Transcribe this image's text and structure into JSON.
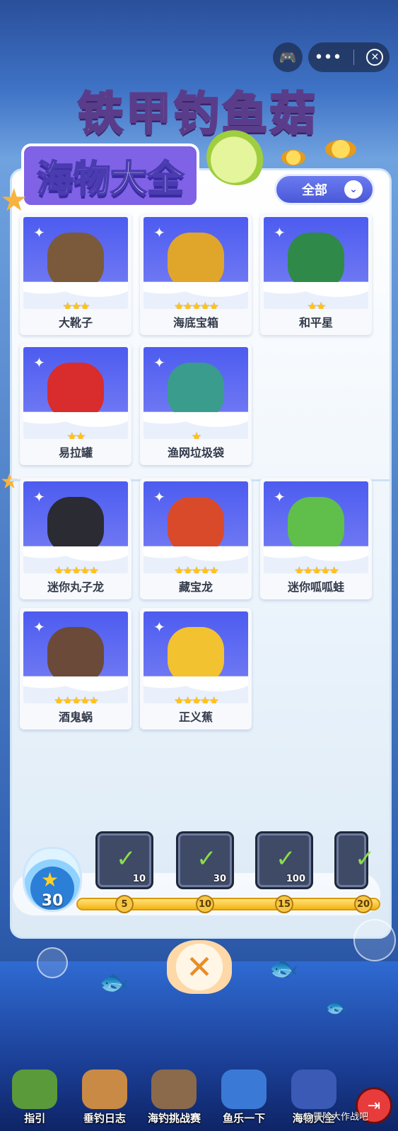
{
  "capsule": {
    "menu_glyph": "•••",
    "close_glyph": "✕",
    "gamepad_glyph": "🎮"
  },
  "game_title": "铁甲钓鱼菇",
  "panel_title": "海物大全",
  "filter": {
    "label": "全部",
    "chevron": "⌄"
  },
  "section_one": {
    "cards": [
      {
        "name": "大靴子",
        "stars": "★★★",
        "color": "#7a5a3a"
      },
      {
        "name": "海底宝箱",
        "stars": "★★★★★",
        "color": "#e0a52b"
      },
      {
        "name": "和平星",
        "stars": "★★",
        "color": "#2f8a4a"
      },
      {
        "name": "易拉罐",
        "stars": "★★",
        "color": "#d92c2c"
      },
      {
        "name": "渔网垃圾袋",
        "stars": "★",
        "color": "#3a9c8c"
      }
    ]
  },
  "section_two": {
    "cards": [
      {
        "name": "迷你丸子龙",
        "stars": "★★★★★",
        "color": "#2b2b33"
      },
      {
        "name": "藏宝龙",
        "stars": "★★★★★",
        "color": "#d94a2a"
      },
      {
        "name": "迷你呱呱蛙",
        "stars": "★★★★★",
        "color": "#5fbf4a"
      },
      {
        "name": "酒鬼蜗",
        "stars": "★★★★★",
        "color": "#6b4a3a"
      },
      {
        "name": "正义蕉",
        "stars": "★★★★★",
        "color": "#f2c230"
      }
    ]
  },
  "progress": {
    "jar_count": "30",
    "milestones": [
      "5",
      "10",
      "15",
      "20"
    ],
    "rewards": [
      {
        "qty": "10",
        "icon": "ticket-icon"
      },
      {
        "qty": "30",
        "icon": "key-icon"
      },
      {
        "qty": "100",
        "icon": "hammer-icon"
      },
      {
        "qty": "",
        "icon": "reward-icon"
      }
    ]
  },
  "close_glyph": "✕",
  "bottom_nav": [
    {
      "label": "指引",
      "icon": "frog-guide-icon",
      "color": "#5a9a3a"
    },
    {
      "label": "垂钓日志",
      "icon": "fishing-log-icon",
      "color": "#c98a45"
    },
    {
      "label": "海钓挑战赛",
      "icon": "challenge-icon",
      "color": "#8a6a4a"
    },
    {
      "label": "鱼乐一下",
      "icon": "wheel-icon",
      "color": "#3a7ad6"
    },
    {
      "label": "海物大全",
      "icon": "encyclopedia-icon",
      "color": "#3a5ab6"
    }
  ],
  "exit_glyph": "⇥",
  "watermark": "@冒险大作战吧"
}
